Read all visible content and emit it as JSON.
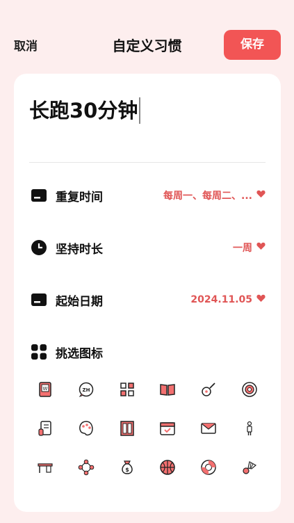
{
  "header": {
    "cancel_label": "取消",
    "title": "自定义习惯",
    "save_label": "保存"
  },
  "habit": {
    "name": "长跑30分钟"
  },
  "settings": {
    "repeat_label": "重复时间",
    "repeat_value": "每周一、每周二、...",
    "duration_label": "坚持时长",
    "duration_value": "一周",
    "start_label": "起始日期",
    "start_value": "2024.11.05",
    "icon_label": "挑选图标"
  },
  "icons": [
    "book-w-icon",
    "chat-zh-icon",
    "qr-code-icon",
    "open-book-icon",
    "guitar-icon",
    "target-icon",
    "scroll-icon",
    "palette-icon",
    "window-icon",
    "calendar-check-icon",
    "mail-icon",
    "person-icon",
    "desk-icon",
    "four-dots-icon",
    "money-bag-icon",
    "basketball-icon",
    "lifebuoy-icon",
    "shuttlecock-icon"
  ],
  "colors": {
    "accent": "#f25555",
    "value_text": "#e05555",
    "background": "#fdeeee"
  }
}
